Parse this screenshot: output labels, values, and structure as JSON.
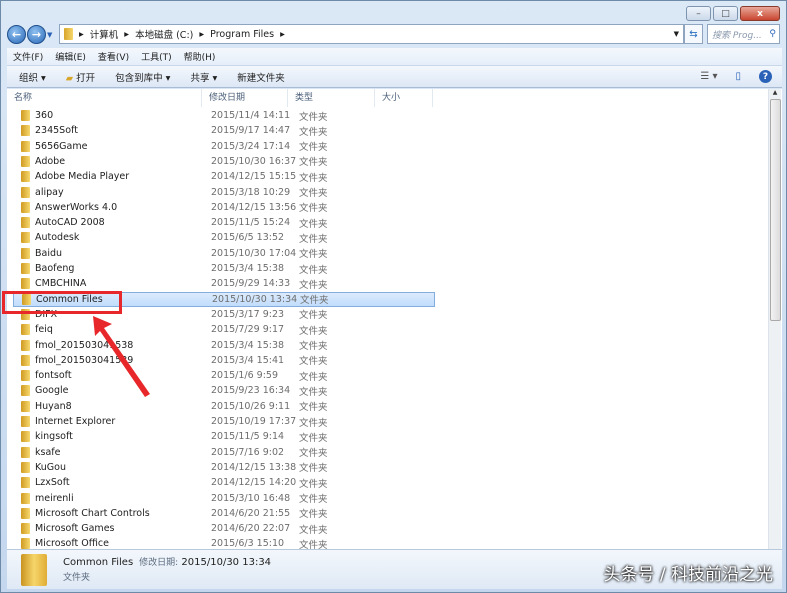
{
  "window": {
    "minimize": "–",
    "maximize": "□",
    "close": "x"
  },
  "address": {
    "crumbs": [
      "计算机",
      "本地磁盘 (C:)",
      "Program Files"
    ],
    "search_placeholder": "搜索 Prog..."
  },
  "menu": [
    "文件(F)",
    "编辑(E)",
    "查看(V)",
    "工具(T)",
    "帮助(H)"
  ],
  "toolbar": {
    "organize": "组织 ▾",
    "open": "打开",
    "include": "包含到库中 ▾",
    "share": "共享 ▾",
    "new_folder": "新建文件夹"
  },
  "columns": [
    "名称",
    "修改日期",
    "类型",
    "大小"
  ],
  "files": [
    [
      "360",
      "2015/11/4 14:11",
      "文件夹"
    ],
    [
      "2345Soft",
      "2015/9/17 14:47",
      "文件夹"
    ],
    [
      "5656Game",
      "2015/3/24 17:14",
      "文件夹"
    ],
    [
      "Adobe",
      "2015/10/30 16:37",
      "文件夹"
    ],
    [
      "Adobe Media Player",
      "2014/12/15 15:15",
      "文件夹"
    ],
    [
      "alipay",
      "2015/3/18 10:29",
      "文件夹"
    ],
    [
      "AnswerWorks 4.0",
      "2014/12/15 13:56",
      "文件夹"
    ],
    [
      "AutoCAD 2008",
      "2015/11/5 15:24",
      "文件夹"
    ],
    [
      "Autodesk",
      "2015/6/5 13:52",
      "文件夹"
    ],
    [
      "Baidu",
      "2015/10/30 17:04",
      "文件夹"
    ],
    [
      "Baofeng",
      "2015/3/4 15:38",
      "文件夹"
    ],
    [
      "CMBCHINA",
      "2015/9/29 14:33",
      "文件夹"
    ],
    [
      "Common Files",
      "2015/10/30 13:34",
      "文件夹"
    ],
    [
      "DIFX",
      "2015/3/17 9:23",
      "文件夹"
    ],
    [
      "feiq",
      "2015/7/29 9:17",
      "文件夹"
    ],
    [
      "fmol_201503041538",
      "2015/3/4 15:38",
      "文件夹"
    ],
    [
      "fmol_201503041539",
      "2015/3/4 15:41",
      "文件夹"
    ],
    [
      "fontsoft",
      "2015/1/6 9:59",
      "文件夹"
    ],
    [
      "Google",
      "2015/9/23 16:34",
      "文件夹"
    ],
    [
      "Huyan8",
      "2015/10/26 9:11",
      "文件夹"
    ],
    [
      "Internet Explorer",
      "2015/10/19 17:37",
      "文件夹"
    ],
    [
      "kingsoft",
      "2015/11/5 9:14",
      "文件夹"
    ],
    [
      "ksafe",
      "2015/7/16 9:02",
      "文件夹"
    ],
    [
      "KuGou",
      "2014/12/15 13:38",
      "文件夹"
    ],
    [
      "LzxSoft",
      "2014/12/15 14:20",
      "文件夹"
    ],
    [
      "meirenli",
      "2015/3/10 16:48",
      "文件夹"
    ],
    [
      "Microsoft Chart Controls",
      "2014/6/20 21:55",
      "文件夹"
    ],
    [
      "Microsoft Games",
      "2014/6/20 22:07",
      "文件夹"
    ],
    [
      "Microsoft Office",
      "2015/6/3 15:10",
      "文件夹"
    ]
  ],
  "selected_index": 12,
  "details": {
    "name": "Common Files",
    "date_label": "修改日期:",
    "date": "2015/10/30 13:34",
    "type": "文件夹"
  },
  "watermark": "头条号 / 科技前沿之光"
}
